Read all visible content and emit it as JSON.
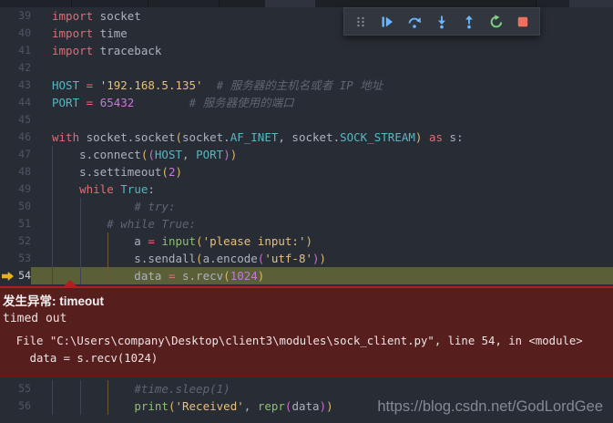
{
  "colors": {
    "editor_bg": "#282c34",
    "current_line_bg": "#5a5f38",
    "exception_bg": "#571e1e",
    "exception_border": "#b31d1d",
    "debug_icon_blue": "#6cb6ff",
    "restart_green": "#7fd183",
    "stop_red": "#f0705f",
    "debug_arrow_gold": "#e7b022",
    "keyword": "#e06c75",
    "constant": "#56b6c2",
    "string": "#e5c07b",
    "number": "#c678dd",
    "comment": "#5f6672",
    "builtin": "#8cbf72"
  },
  "debug_toolbar": {
    "icons": [
      "drag-handle",
      "continue",
      "step-over",
      "step-into",
      "step-out",
      "restart",
      "stop"
    ]
  },
  "editor": {
    "current_line": 54,
    "lines_top": [
      {
        "no": 39,
        "tokens": [
          [
            "kw",
            "import"
          ],
          [
            "plain",
            " socket"
          ]
        ]
      },
      {
        "no": 40,
        "tokens": [
          [
            "kw",
            "import"
          ],
          [
            "plain",
            " time"
          ]
        ]
      },
      {
        "no": 41,
        "tokens": [
          [
            "kw",
            "import"
          ],
          [
            "plain",
            " traceback"
          ]
        ]
      },
      {
        "no": 42,
        "tokens": []
      },
      {
        "no": 43,
        "tokens": [
          [
            "const",
            "HOST"
          ],
          [
            "plain",
            " "
          ],
          [
            "op",
            "="
          ],
          [
            "plain",
            " "
          ],
          [
            "str",
            "'192.168.5.135'"
          ],
          [
            "plain",
            "  "
          ],
          [
            "com",
            "# 服务器的主机名或者 IP 地址"
          ]
        ]
      },
      {
        "no": 44,
        "tokens": [
          [
            "const",
            "PORT"
          ],
          [
            "plain",
            " "
          ],
          [
            "op",
            "="
          ],
          [
            "plain",
            " "
          ],
          [
            "num",
            "65432"
          ],
          [
            "plain",
            "        "
          ],
          [
            "com",
            "# 服务器使用的端口"
          ]
        ]
      },
      {
        "no": 45,
        "tokens": []
      },
      {
        "no": 46,
        "tokens": [
          [
            "kw",
            "with"
          ],
          [
            "plain",
            " socket.socket"
          ],
          [
            "b1",
            "("
          ],
          [
            "plain",
            "socket."
          ],
          [
            "const",
            "AF_INET"
          ],
          [
            "plain",
            ", socket."
          ],
          [
            "const",
            "SOCK_STREAM"
          ],
          [
            "b1",
            ")"
          ],
          [
            "plain",
            " "
          ],
          [
            "kw",
            "as"
          ],
          [
            "plain",
            " s:"
          ]
        ]
      },
      {
        "no": 47,
        "tokens": [
          [
            "plain",
            "    s.connect"
          ],
          [
            "b1",
            "("
          ],
          [
            "b2",
            "("
          ],
          [
            "const",
            "HOST"
          ],
          [
            "plain",
            ", "
          ],
          [
            "const",
            "PORT"
          ],
          [
            "b2",
            ")"
          ],
          [
            "b1",
            ")"
          ]
        ]
      },
      {
        "no": 48,
        "tokens": [
          [
            "plain",
            "    s.settimeout"
          ],
          [
            "b1",
            "("
          ],
          [
            "num",
            "2"
          ],
          [
            "b1",
            ")"
          ]
        ]
      },
      {
        "no": 49,
        "tokens": [
          [
            "plain",
            "    "
          ],
          [
            "kw",
            "while"
          ],
          [
            "plain",
            " "
          ],
          [
            "const",
            "True"
          ],
          [
            "plain",
            ":"
          ]
        ]
      },
      {
        "no": 50,
        "tokens": [
          [
            "plain",
            "            "
          ],
          [
            "com",
            "# try:"
          ]
        ]
      },
      {
        "no": 51,
        "tokens": [
          [
            "plain",
            "        "
          ],
          [
            "com",
            "# while True:"
          ]
        ]
      },
      {
        "no": 52,
        "tokens": [
          [
            "plain",
            "            a "
          ],
          [
            "op",
            "="
          ],
          [
            "plain",
            " "
          ],
          [
            "fn",
            "input"
          ],
          [
            "b1",
            "("
          ],
          [
            "str",
            "'please input:'"
          ],
          [
            "b1",
            ")"
          ]
        ]
      },
      {
        "no": 53,
        "tokens": [
          [
            "plain",
            "            s.sendall"
          ],
          [
            "b1",
            "("
          ],
          [
            "plain",
            "a.encode"
          ],
          [
            "b2",
            "("
          ],
          [
            "str",
            "'utf-8'"
          ],
          [
            "b2",
            ")"
          ],
          [
            "b1",
            ")"
          ]
        ]
      },
      {
        "no": 54,
        "tokens": [
          [
            "plain",
            "            data "
          ],
          [
            "op",
            "="
          ],
          [
            "plain",
            " s.recv"
          ],
          [
            "b1",
            "("
          ],
          [
            "num",
            "1024"
          ],
          [
            "b1",
            ")"
          ]
        ]
      }
    ],
    "lines_bottom": [
      {
        "no": 55,
        "tokens": [
          [
            "plain",
            "            "
          ],
          [
            "com",
            "#time.sleep(1)"
          ]
        ]
      },
      {
        "no": 56,
        "tokens": [
          [
            "plain",
            "            "
          ],
          [
            "fn",
            "print"
          ],
          [
            "b1",
            "("
          ],
          [
            "str",
            "'Received'"
          ],
          [
            "plain",
            ", "
          ],
          [
            "fn",
            "repr"
          ],
          [
            "b2",
            "("
          ],
          [
            "plain",
            "data"
          ],
          [
            "b2",
            ")"
          ],
          [
            "b1",
            ")"
          ]
        ]
      }
    ]
  },
  "exception_panel": {
    "title": "发生异常: timeout",
    "message": "timed out",
    "trace_file_line": "  File \"C:\\Users\\company\\Desktop\\client3\\modules\\sock_client.py\", line 54, in <module>",
    "trace_code_line": "    data = s.recv(1024)"
  },
  "watermark": {
    "text": "https://blog.csdn.net/GodLordGee"
  }
}
